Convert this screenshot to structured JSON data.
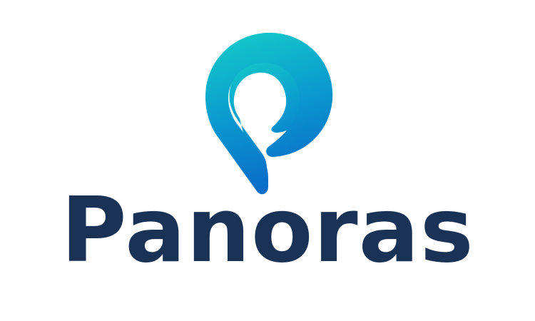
{
  "brand": {
    "name": "Panoras",
    "colors": {
      "wordmark": "#1b3257",
      "gradient_top": "#14cfc8",
      "gradient_bottom": "#0a6ec9",
      "background": "#ffffff"
    },
    "icon": "location-pin-p-icon"
  }
}
